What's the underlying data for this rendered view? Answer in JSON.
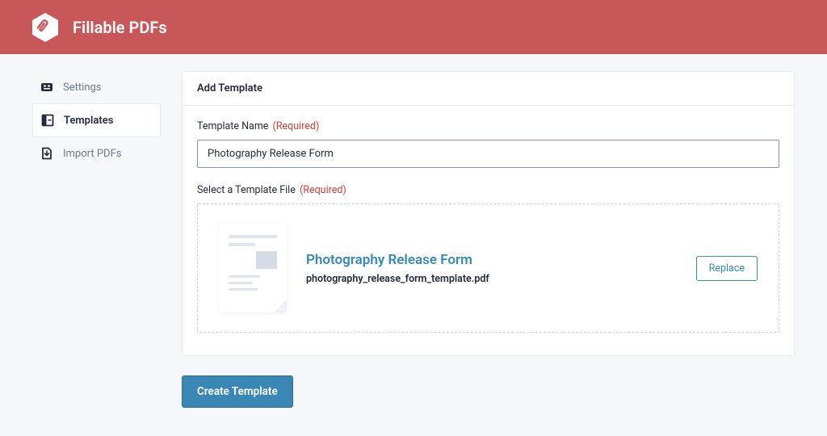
{
  "brand": {
    "name": "Fillable PDFs"
  },
  "sidebar": {
    "items": [
      {
        "label": "Settings"
      },
      {
        "label": "Templates"
      },
      {
        "label": "Import PDFs"
      }
    ]
  },
  "card": {
    "title": "Add Template",
    "name_label": "Template Name",
    "name_required": "(Required)",
    "name_value": "Photography Release Form",
    "file_label": "Select a Template File",
    "file_required": "(Required)",
    "selected_file": {
      "title": "Photography Release Form",
      "filename": "photography_release_form_template.pdf"
    },
    "replace_label": "Replace"
  },
  "actions": {
    "submit_label": "Create Template"
  },
  "colors": {
    "header": "#c75759",
    "accent": "#3a87b5",
    "required": "#c24141"
  }
}
